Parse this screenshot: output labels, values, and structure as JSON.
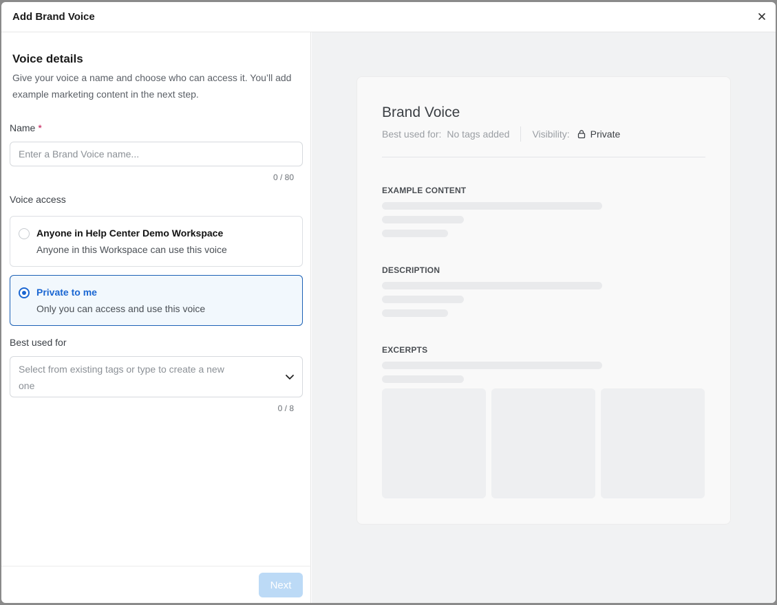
{
  "modal": {
    "title": "Add Brand Voice"
  },
  "form": {
    "section_title": "Voice details",
    "section_desc": "Give your voice a name and choose who can access it. You’ll add example marketing content in the next step.",
    "name_label": "Name",
    "name_required": "*",
    "name_placeholder": "Enter a Brand Voice name...",
    "name_value": "",
    "name_counter": "0 / 80",
    "access_label": "Voice access",
    "access_options": [
      {
        "title": "Anyone in Help Center Demo Workspace",
        "desc": "Anyone in this Workspace can use this voice",
        "selected": false
      },
      {
        "title": "Private to me",
        "desc": "Only you can access and use this voice",
        "selected": true
      }
    ],
    "best_used_label": "Best used for",
    "best_used_placeholder": "Select from existing tags or type to create a new one",
    "best_used_counter": "0 / 8",
    "next_label": "Next"
  },
  "preview": {
    "title": "Brand Voice",
    "best_used_label": "Best used for:",
    "best_used_value": "No tags added",
    "visibility_label": "Visibility:",
    "visibility_value": "Private",
    "sections": [
      "EXAMPLE CONTENT",
      "DESCRIPTION",
      "EXCERPTS"
    ]
  },
  "colors": {
    "accent": "#1a66d2",
    "selected_card_bg": "#f2f8fd",
    "next_disabled": "#bcdaf6",
    "required": "#c0124f"
  },
  "icons": {
    "close": "close-icon",
    "chevron": "chevron-down-icon",
    "lock": "lock-icon"
  }
}
